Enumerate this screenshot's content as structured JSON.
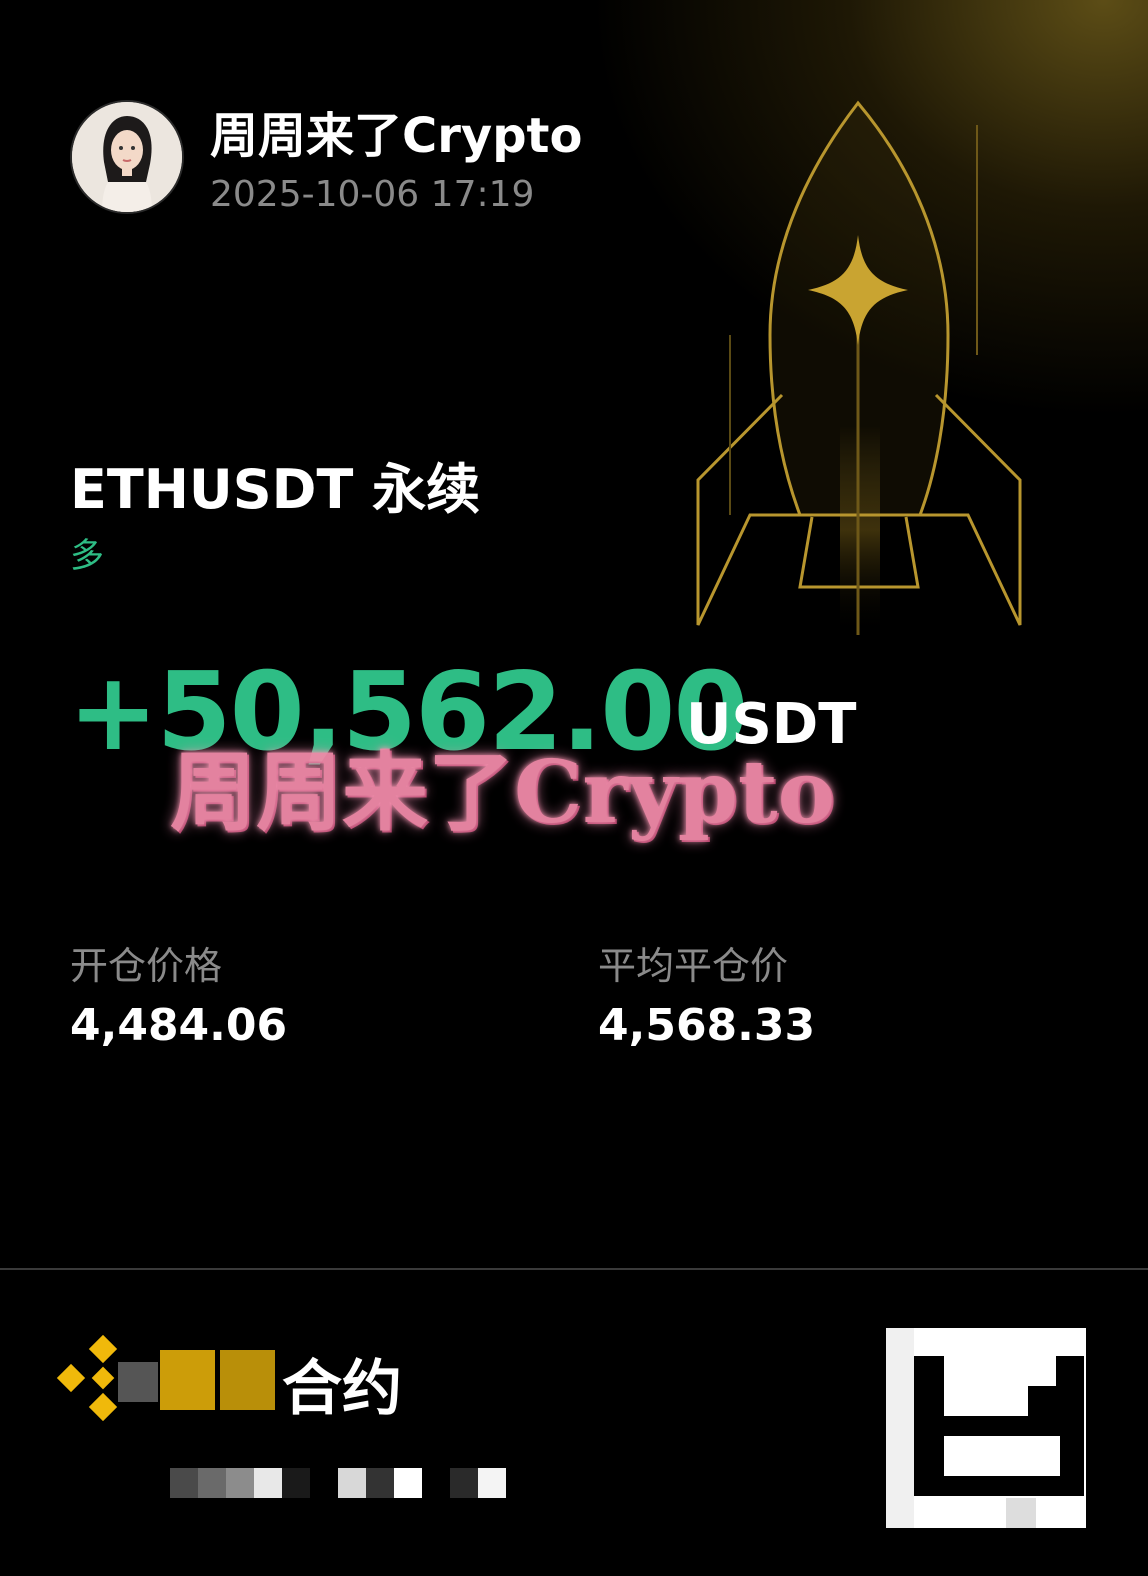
{
  "colors": {
    "accent_green": "#2ebd85",
    "gold": "#b8962e",
    "watermark_pink": "#f08aa8"
  },
  "header": {
    "username": "周周来了Crypto",
    "timestamp": "2025-10-06 17:19"
  },
  "position": {
    "symbol": "ETHUSDT 永续",
    "side": "多",
    "pnl": "+50,562.00",
    "pnl_unit": "USDT"
  },
  "watermark": "周周来了Crypto",
  "prices": {
    "entry_label": "开仓价格",
    "entry_value": "4,484.06",
    "close_label": "平均平仓价",
    "close_value": "4,568.33"
  },
  "footer": {
    "brand_text": "合约",
    "brand_icon": "binance-logo-icon",
    "qr_icon": "qr-code-icon"
  }
}
